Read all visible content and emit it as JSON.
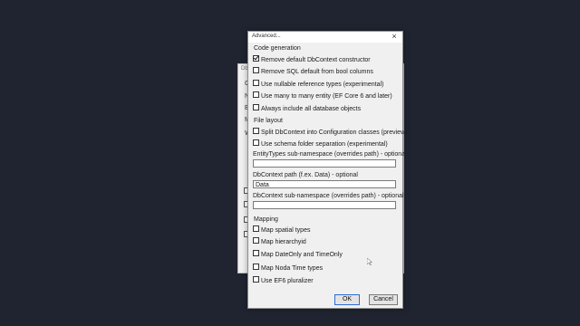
{
  "background_dialog": {
    "title": "Db",
    "fragments": [
      "C",
      "N",
      "E",
      "M",
      "W"
    ]
  },
  "dialog": {
    "title": "Advanced...",
    "close_glyph": "×",
    "sections": {
      "code_generation": "Code generation",
      "file_layout": "File layout",
      "mapping": "Mapping"
    },
    "code_generation_options": [
      {
        "label": "Remove default DbContext constructor",
        "checked": true
      },
      {
        "label": "Remove SQL default from bool columns",
        "checked": false
      },
      {
        "label": "Use nullable reference types (experimental)",
        "checked": false
      },
      {
        "label": "Use many to many entity (EF Core 6 and later)",
        "checked": false
      },
      {
        "label": "Always include all database objects",
        "checked": false
      }
    ],
    "file_layout_options": [
      {
        "label": "Split DbContext into Configuration classes (preview)",
        "checked": false
      },
      {
        "label": "Use schema folder separation (experimental)",
        "checked": false
      }
    ],
    "fields": {
      "entity_types_ns_label": "EntityTypes sub-namespace (overrides path) - optional",
      "entity_types_ns_value": "",
      "dbcontext_path_label": "DbContext path (f.ex. Data) - optional",
      "dbcontext_path_value": "Data",
      "dbcontext_ns_label": "DbContext sub-namespace (overrides path) - optional",
      "dbcontext_ns_value": ""
    },
    "mapping_options": [
      {
        "label": "Map spatial types",
        "checked": false
      },
      {
        "label": "Map hierarchyid",
        "checked": false
      },
      {
        "label": "Map DateOnly and TimeOnly",
        "checked": false
      },
      {
        "label": "Map Noda Time types",
        "checked": false
      },
      {
        "label": "Use EF6 pluralizer",
        "checked": false
      }
    ],
    "buttons": {
      "ok": "OK",
      "cancel": "Cancel"
    }
  },
  "icons": {
    "close": "close-icon",
    "checkbox_checked": "check-icon",
    "cursor": "mouse-pointer-icon"
  }
}
